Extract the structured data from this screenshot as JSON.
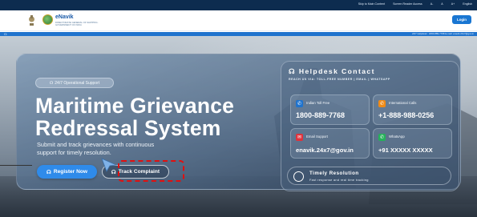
{
  "topbar": {
    "skip_link": "Skip to Main Content",
    "screen_reader": "Screen Reader Access",
    "font_minus": "A-",
    "font_normal": "A",
    "font_plus": "A+",
    "language": "English"
  },
  "header": {
    "brand_name": "eNavik",
    "brand_subtitle": "DIRECTORATE GENERAL OF SHIPPING · GOVERNMENT OF INDIA",
    "login_label": "Login"
  },
  "strip": {
    "info_text": "24/7 Helpdesk : 1800-889-7768   E-mail: enavik.24x7@gov.in"
  },
  "hero": {
    "badge": "24/7 Operational Support",
    "title_line1": "Maritime Grievance",
    "title_line2": "Redressal System",
    "subtitle": "Submit and track grievances with continuous support for timely resolution.",
    "register_label": "Register Now",
    "track_label": "Track Complaint"
  },
  "helpdesk": {
    "title": "Helpdesk Contact",
    "subtitle": "REACH US VIA: TOLL-FREE NUMBER | EMAIL | WHATSAPP",
    "tiles": [
      {
        "label": "Indian Toll Free",
        "value": "1800-889-7768",
        "color": "#1f73cd",
        "icon": "phone-icon"
      },
      {
        "label": "International Calls",
        "value": "+1-888-988-0256",
        "color": "#ef8a17",
        "icon": "phone-icon"
      },
      {
        "label": "Email Support",
        "value": "enavik.24x7@gov.in",
        "color": "#e0323c",
        "icon": "mail-icon"
      },
      {
        "label": "WhatsApp",
        "value": "+91 XXXXX XXXXX",
        "color": "#25b05a",
        "icon": "whatsapp-icon"
      }
    ],
    "timely_title": "Timely Resolution",
    "timely_desc": "Fast response and real time tracking"
  },
  "colors": {
    "primary": "#1976d2",
    "accent_blue": "#2f8bea",
    "annotation_red": "#e01010"
  }
}
